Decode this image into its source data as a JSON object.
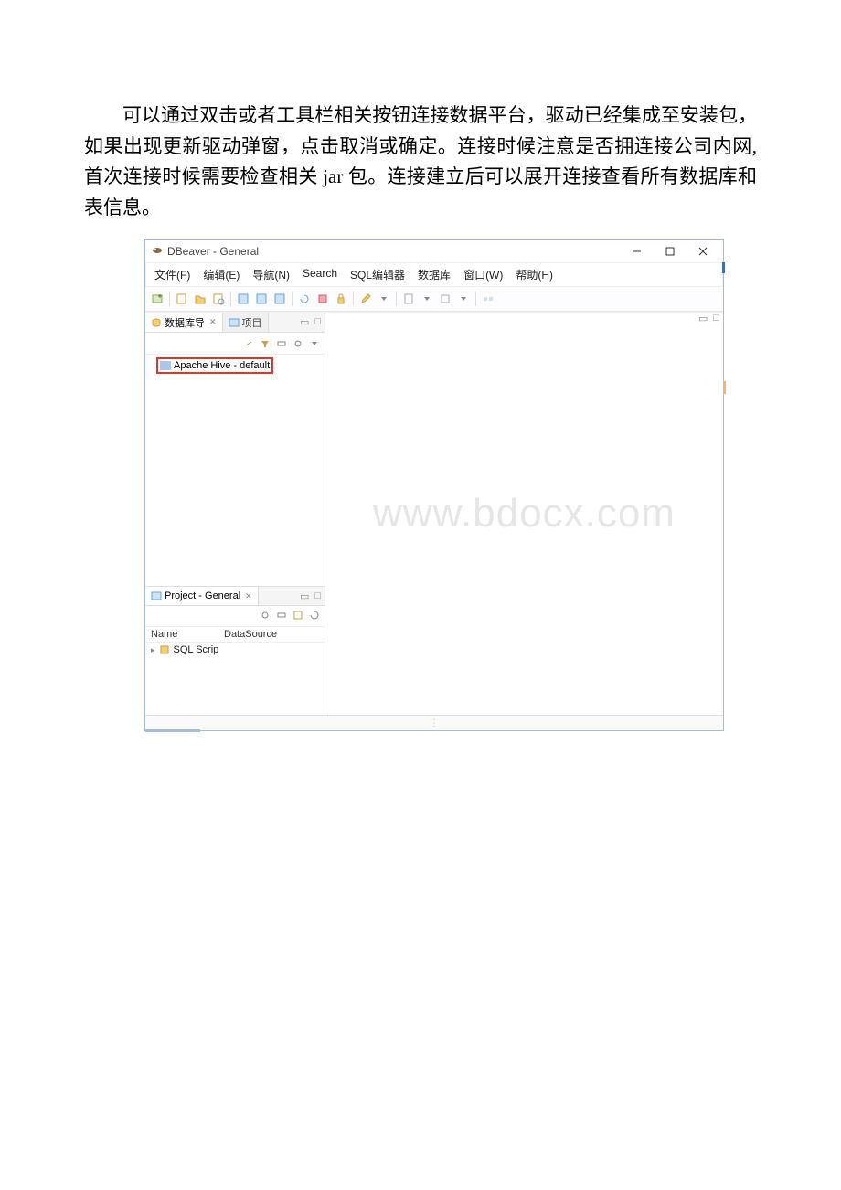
{
  "doc": {
    "paragraph": "可以通过双击或者工具栏相关按钮连接数据平台，驱动已经集成至安装包，如果出现更新驱动弹窗，点击取消或确定。连接时候注意是否拥连接公司内网,首次连接时候需要检查相关 jar 包。连接建立后可以展开连接查看所有数据库和表信息。"
  },
  "window": {
    "title": "DBeaver - General"
  },
  "menu": {
    "file": "文件(F)",
    "edit": "编辑(E)",
    "navigate": "导航(N)",
    "search": "Search",
    "sql": "SQL编辑器",
    "database": "数据库",
    "window": "窗口(W)",
    "help": "帮助(H)"
  },
  "nav_panel": {
    "tab_db": "数据库导",
    "tab_proj": "项目",
    "connection": "Apache Hive - default"
  },
  "project_panel": {
    "tab": "Project - General",
    "col_name": "Name",
    "col_ds": "DataSource",
    "item": "SQL Scrip"
  },
  "watermark": "www.bdocx.com"
}
